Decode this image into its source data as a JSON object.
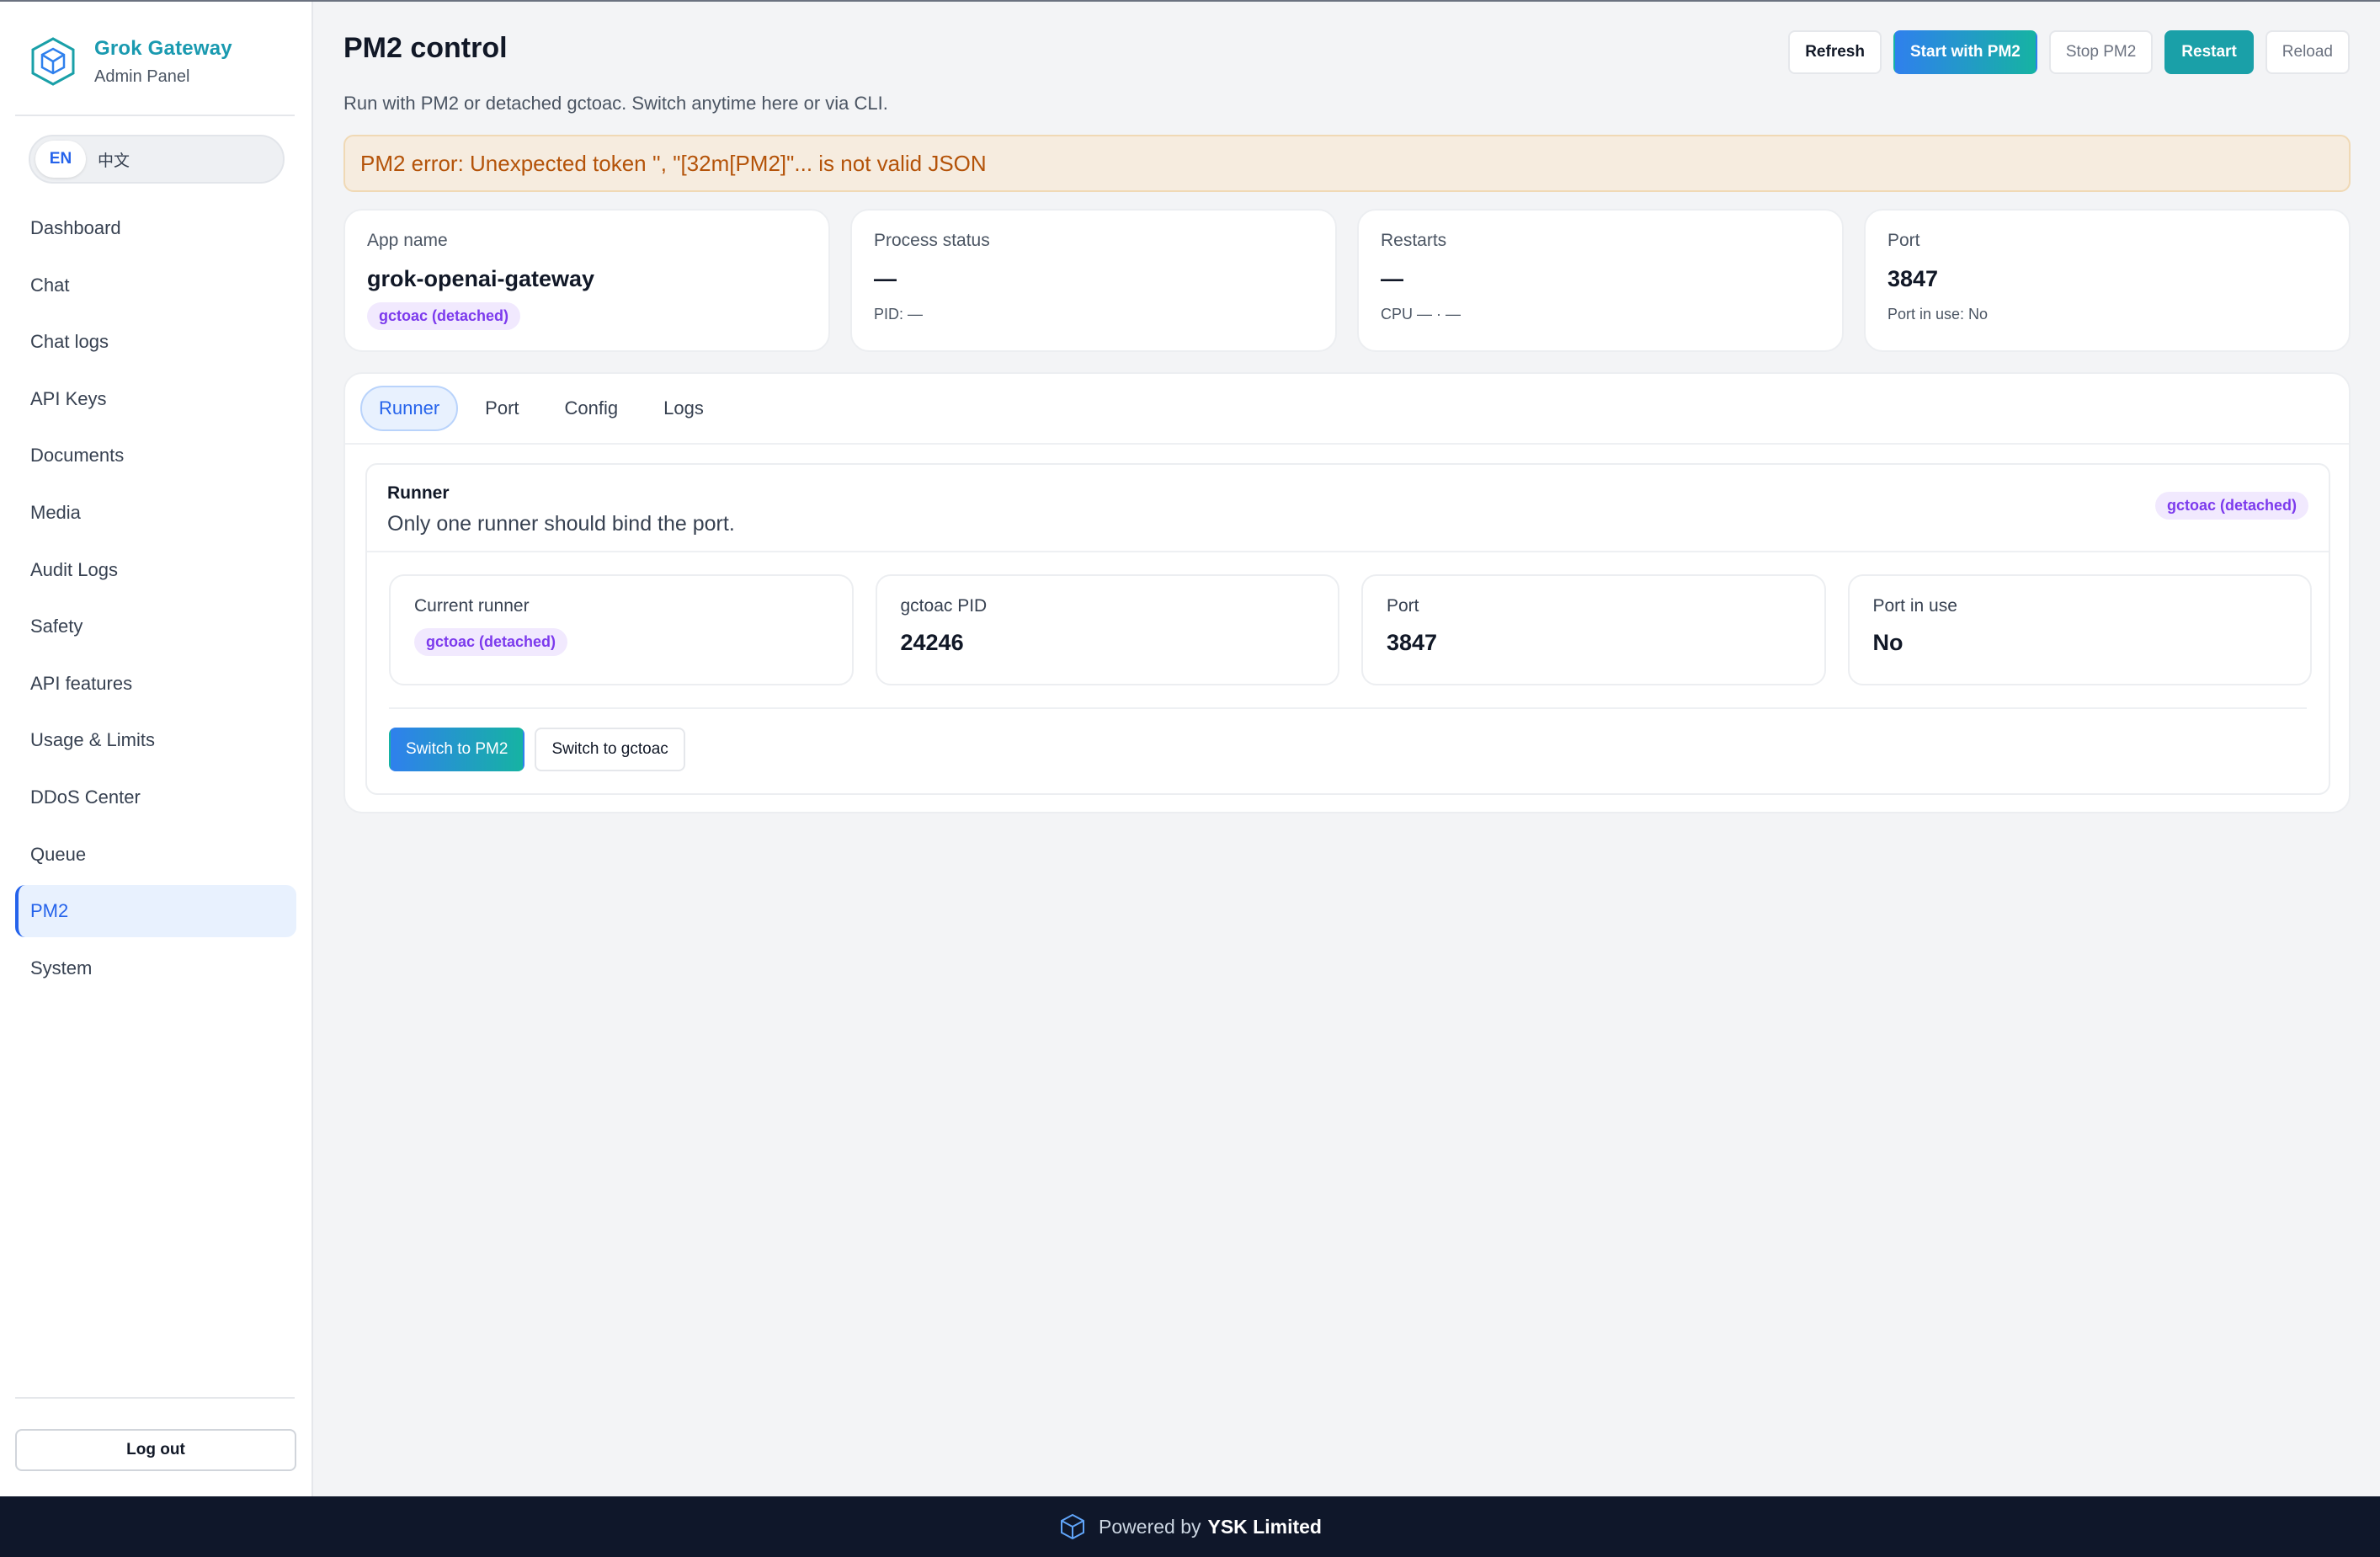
{
  "brand": {
    "title": "Grok Gateway",
    "subtitle": "Admin Panel",
    "logo_icon": "cube-icon"
  },
  "lang": {
    "en": "EN",
    "zh": "中文",
    "selected": "EN"
  },
  "sidebar": {
    "items": [
      {
        "label": "Dashboard"
      },
      {
        "label": "Chat"
      },
      {
        "label": "Chat logs"
      },
      {
        "label": "API Keys"
      },
      {
        "label": "Documents"
      },
      {
        "label": "Media"
      },
      {
        "label": "Audit Logs"
      },
      {
        "label": "Safety"
      },
      {
        "label": "API features"
      },
      {
        "label": "Usage & Limits"
      },
      {
        "label": "DDoS Center"
      },
      {
        "label": "Queue"
      },
      {
        "label": "PM2",
        "active": true
      },
      {
        "label": "System"
      }
    ],
    "logout": "Log out"
  },
  "header": {
    "title": "PM2 control",
    "subtitle": "Run with PM2 or detached gctoac. Switch anytime here or via CLI.",
    "buttons": {
      "refresh": "Refresh",
      "start": "Start with PM2",
      "stop": "Stop PM2",
      "restart": "Restart",
      "reload": "Reload"
    }
  },
  "alert": {
    "text": "PM2 error: Unexpected token '\u001b', \"\u001b[32m[PM2]\"... is not valid JSON"
  },
  "stats": {
    "app": {
      "label": "App name",
      "value": "grok-openai-gateway",
      "badge": "gctoac (detached)"
    },
    "process": {
      "label": "Process status",
      "value": "—",
      "meta": "PID: —"
    },
    "restarts": {
      "label": "Restarts",
      "value": "—",
      "meta": "CPU — · —"
    },
    "port": {
      "label": "Port",
      "value": "3847",
      "meta": "Port in use: No"
    }
  },
  "tabs": [
    {
      "label": "Runner",
      "active": true
    },
    {
      "label": "Port"
    },
    {
      "label": "Config"
    },
    {
      "label": "Logs"
    }
  ],
  "runner": {
    "title": "Runner",
    "description": "Only one runner should bind the port.",
    "badge": "gctoac (detached)",
    "cards": {
      "current": {
        "label": "Current runner",
        "badge": "gctoac (detached)"
      },
      "pid": {
        "label": "gctoac PID",
        "value": "24246"
      },
      "port": {
        "label": "Port",
        "value": "3847"
      },
      "in_use": {
        "label": "Port in use",
        "value": "No"
      }
    },
    "buttons": {
      "to_pm2": "Switch to PM2",
      "to_gctoac": "Switch to gctoac"
    }
  },
  "footer": {
    "prefix": "Powered by",
    "company": "YSK Limited"
  },
  "colors": {
    "accent": "#2563eb",
    "brand": "#1a9ab0",
    "teal": "#1aa0a8",
    "alert_text": "#b45309",
    "footer_bg": "#0f172a"
  }
}
